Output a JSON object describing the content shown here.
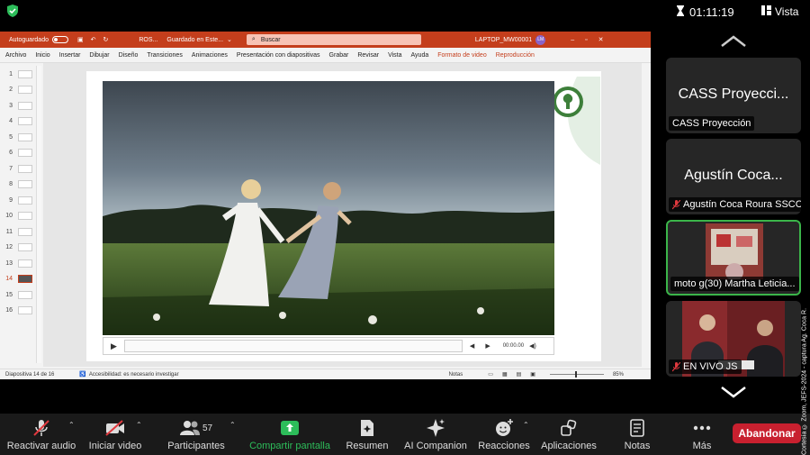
{
  "topbar": {
    "timer": "01:11:19",
    "view_label": "Vista"
  },
  "powerpoint": {
    "autosave_label": "Autoguardado",
    "doc_name": "ROS...",
    "saved_status": "Guardado en Este...",
    "search_placeholder": "Buscar",
    "device_name": "LAPTOP_MW00001",
    "avatar_initials": "LM",
    "ribbon_tabs": [
      "Archivo",
      "Inicio",
      "Insertar",
      "Dibujar",
      "Diseño",
      "Transiciones",
      "Animaciones",
      "Presentación con diapositivas",
      "Grabar",
      "Revisar",
      "Vista",
      "Ayuda",
      "Formato de video",
      "Reproducción"
    ],
    "slide_numbers": [
      "1",
      "2",
      "3",
      "4",
      "5",
      "6",
      "7",
      "8",
      "9",
      "10",
      "11",
      "12",
      "13",
      "14",
      "15",
      "16"
    ],
    "selected_slide": "14",
    "video_time": "00:00.00",
    "status_slide": "Diapositiva 14 de 16",
    "status_accessibility": "Accesibilidad: es necesario investigar",
    "status_notes": "Notas",
    "zoom_level": "85%"
  },
  "participants_panel": [
    {
      "big_name": "CASS Proyecci...",
      "tag": "CASS Proyección",
      "muted": false
    },
    {
      "big_name": "Agustín Coca...",
      "tag": "Agustín Coca Roura SSCC",
      "muted": true
    },
    {
      "big_name": "",
      "tag": "moto g(30) Martha Leticia...",
      "muted": false,
      "active": true
    },
    {
      "big_name": "",
      "tag": "EN VIVO JS",
      "muted": true
    }
  ],
  "toolbar": {
    "mute_label": "Reactivar audio",
    "video_label": "Iniciar video",
    "participants_label": "Participantes",
    "participants_count": "57",
    "share_label": "Compartir pantalla",
    "summary_label": "Resumen",
    "ai_label": "AI Companion",
    "reactions_label": "Reacciones",
    "apps_label": "Aplicaciones",
    "notes_label": "Notas",
    "more_label": "Más",
    "leave_label": "Abandonar"
  },
  "watermark": "Cortesía © Zoom, JEFS-2024 - captura Ag. Coca R.",
  "colors": {
    "ppt_red": "#c43e1c",
    "leave_red": "#c8202f",
    "share_green": "#2dbd5a",
    "active_border": "#3bb54a"
  }
}
